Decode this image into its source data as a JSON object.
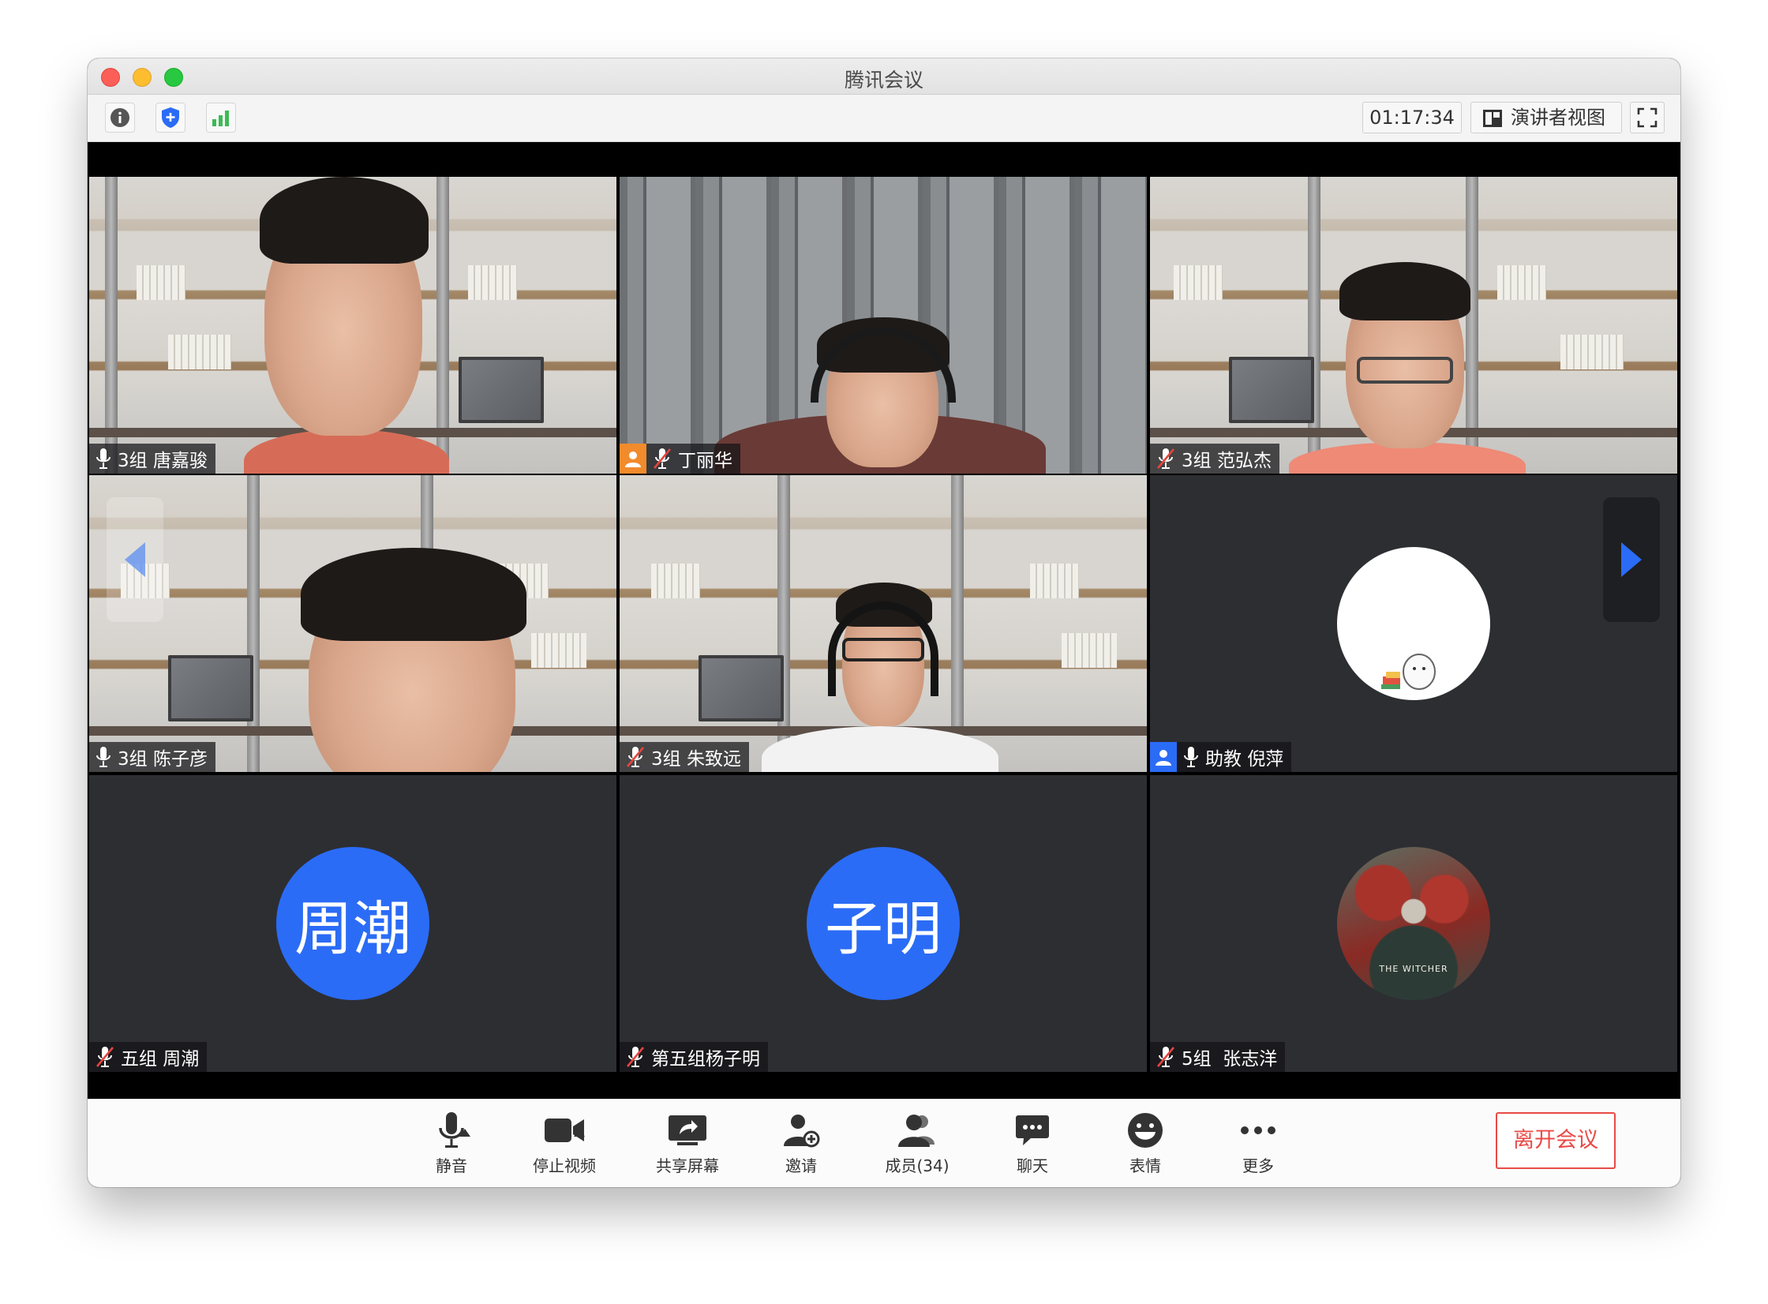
{
  "window": {
    "title": "腾讯会议"
  },
  "toolbar": {
    "timer": "01:17:34",
    "speaker_view_label": "演讲者视图",
    "icons": [
      "info-icon",
      "shield-icon",
      "signal-icon",
      "fullscreen-icon"
    ]
  },
  "participants": [
    {
      "name": "3组 唐嘉骏",
      "mic": "on",
      "video": "on"
    },
    {
      "name": "丁丽华",
      "mic": "muted",
      "video": "on",
      "role": "host"
    },
    {
      "name": "3组 范弘杰",
      "mic": "muted",
      "video": "on"
    },
    {
      "name": "3组 陈子彦",
      "mic": "on",
      "video": "on"
    },
    {
      "name": "3组 朱致远",
      "mic": "muted",
      "video": "on"
    },
    {
      "name": "助教 倪萍",
      "mic": "on",
      "video": "off",
      "role": "co-host"
    },
    {
      "name": "五组 周潮",
      "mic": "muted",
      "video": "off",
      "avatar_text": "周潮"
    },
    {
      "name": "第五组杨子明",
      "mic": "muted",
      "video": "off",
      "avatar_text": "子明"
    },
    {
      "name": "5组  张志洋",
      "mic": "muted",
      "video": "off",
      "avatar_caption": "THE WITCHER"
    }
  ],
  "controls": {
    "mute": "静音",
    "stop_video": "停止视频",
    "share_screen": "共享屏幕",
    "invite": "邀请",
    "members": "成员(34)",
    "chat": "聊天",
    "reactions": "表情",
    "more": "更多",
    "leave": "离开会议"
  },
  "colors": {
    "accent_blue": "#2b6cf6",
    "leave_red": "#e84b46",
    "muted_red": "#e5453f",
    "tile_bg": "#2d2e32"
  }
}
